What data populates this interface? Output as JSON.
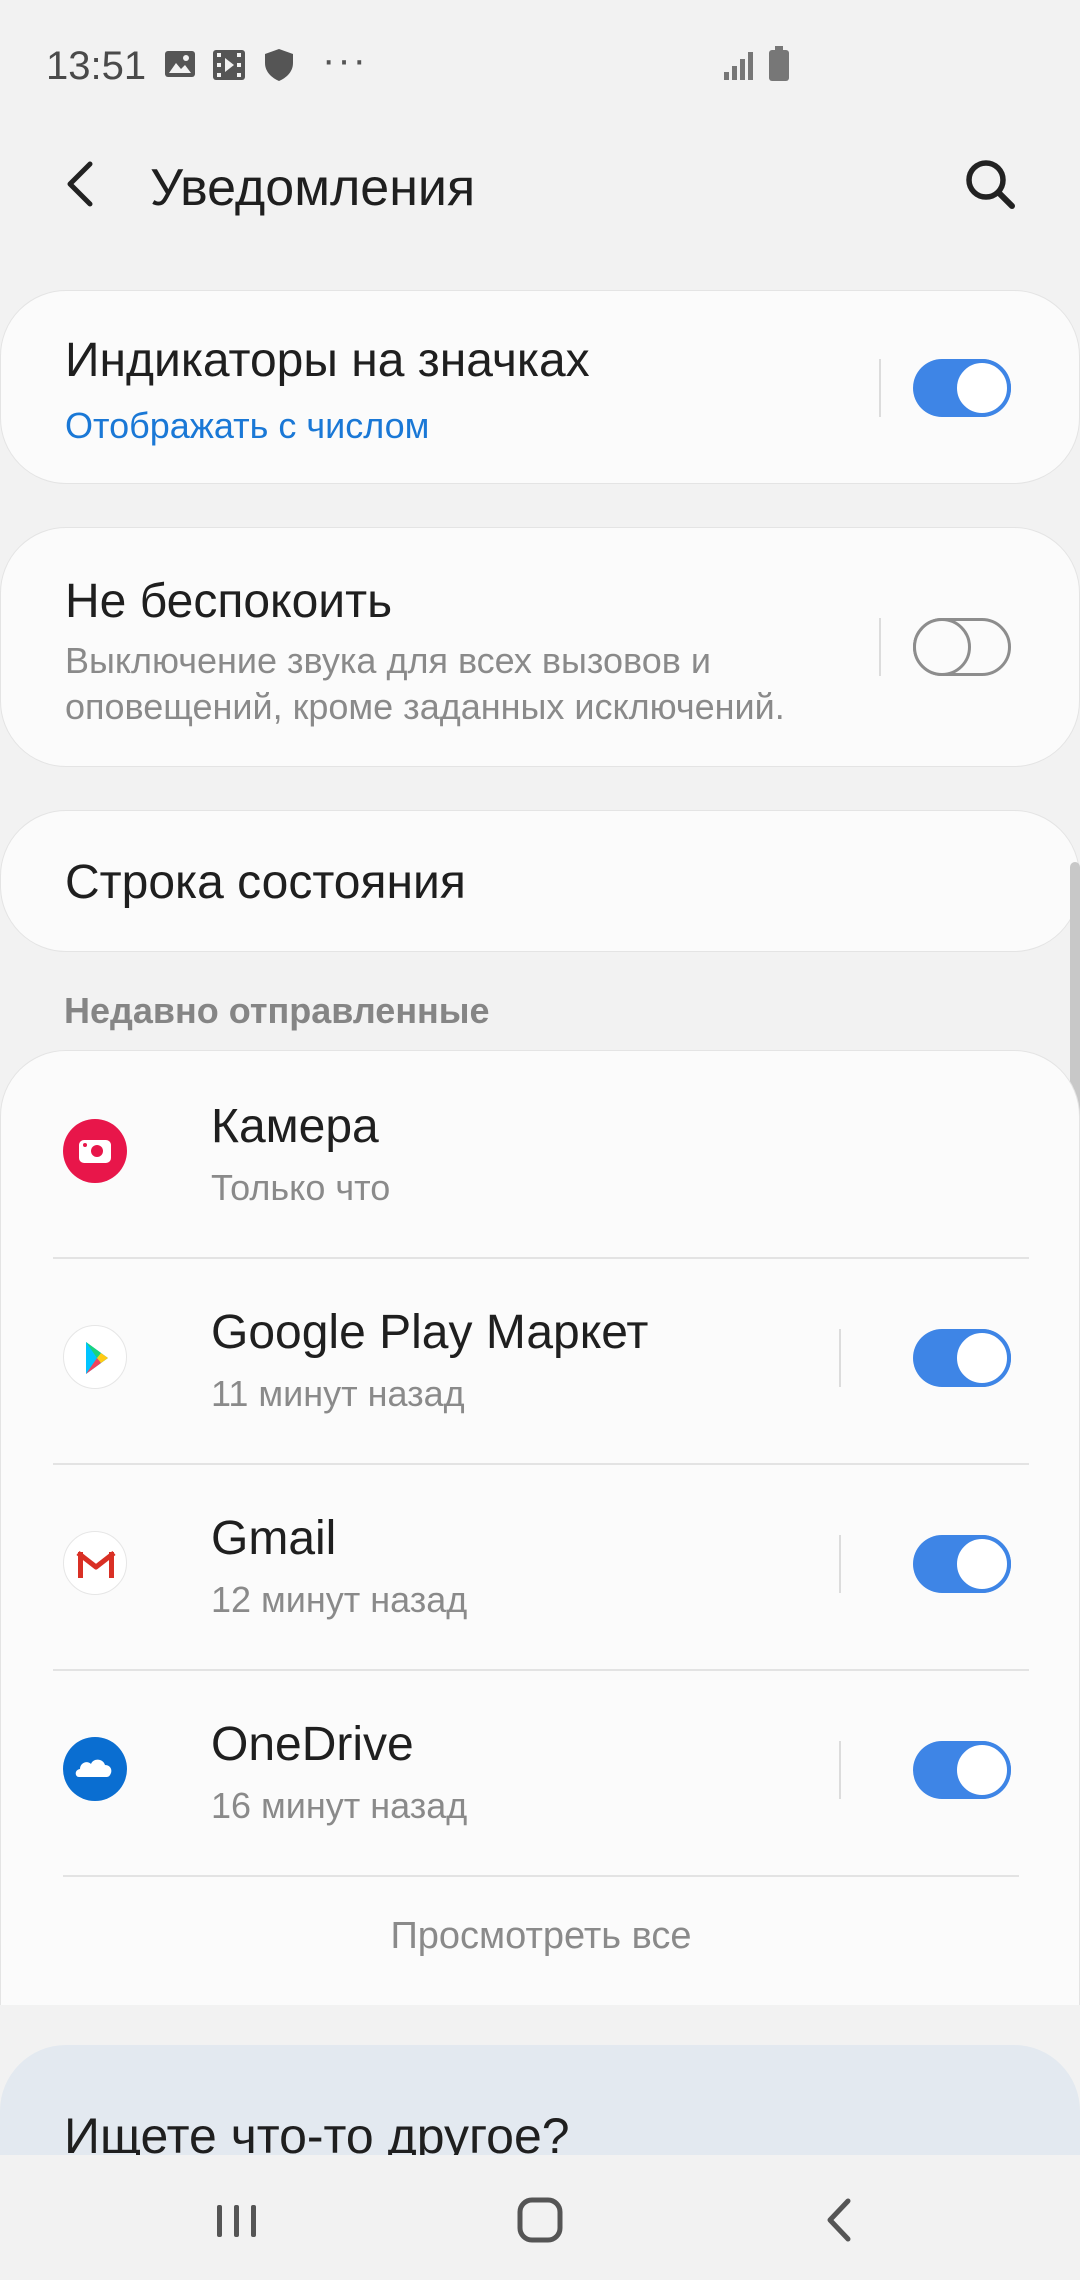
{
  "status_bar": {
    "time": "13:51",
    "icons": [
      "gallery-icon",
      "video-icon",
      "shield-icon"
    ],
    "more": "···",
    "signal": "signal-icon",
    "battery": "battery-icon"
  },
  "header": {
    "title": "Уведомления",
    "back_icon": "back-arrow-icon",
    "search_icon": "search-icon"
  },
  "badges": {
    "title": "Индикаторы на значках",
    "subtitle": "Отображать с числом",
    "enabled": true
  },
  "dnd": {
    "title": "Не беспокоить",
    "subtitle_line1": "Выключение звука для всех вызовов и",
    "subtitle_line2": "оповещений, кроме заданных исключений.",
    "enabled": false
  },
  "status_row": {
    "title": "Строка состояния"
  },
  "recent": {
    "header": "Недавно отправленные",
    "apps": [
      {
        "name": "Камера",
        "time": "Только что",
        "icon": "camera-app-icon",
        "has_toggle": false
      },
      {
        "name": "Google Play Маркет",
        "time": "11 минут назад",
        "icon": "play-store-icon",
        "has_toggle": true,
        "enabled": true
      },
      {
        "name": "Gmail",
        "time": "12 минут назад",
        "icon": "gmail-icon",
        "has_toggle": true,
        "enabled": true
      },
      {
        "name": "OneDrive",
        "time": "16 минут назад",
        "icon": "onedrive-icon",
        "has_toggle": true,
        "enabled": true
      }
    ],
    "view_all": "Просмотреть все"
  },
  "other": {
    "title": "Ищете что-то другое?"
  },
  "nav": {
    "recents": "recents-icon",
    "home": "home-icon",
    "back": "back-icon"
  },
  "colors": {
    "accent": "#3e85e6",
    "link": "#1a78d6",
    "background": "#f2f2f2",
    "card": "#fbfbfb"
  }
}
